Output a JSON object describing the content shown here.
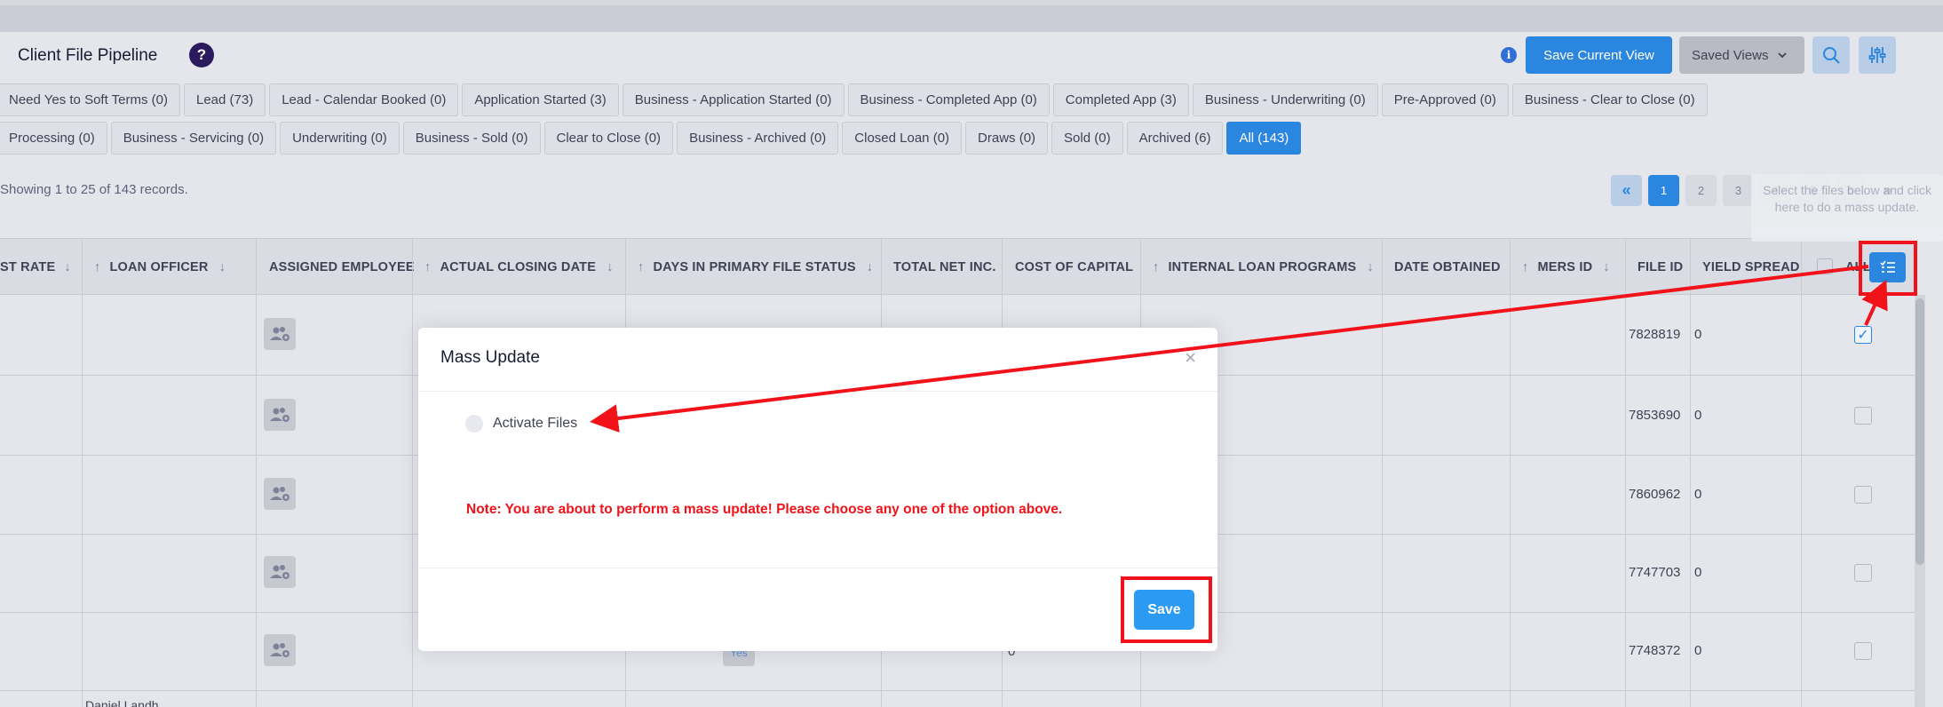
{
  "header": {
    "title": "Client File Pipeline",
    "save_view_label": "Save Current View",
    "saved_views_label": "Saved Views",
    "icons": [
      "help-icon",
      "info-icon",
      "search-icon",
      "filter-settings-icon"
    ]
  },
  "tabs_row1": [
    "Need Yes to Soft Terms (0)",
    "Lead (73)",
    "Lead - Calendar Booked (0)",
    "Application Started (3)",
    "Business - Application Started (0)",
    "Business - Completed App (0)",
    "Completed App (3)",
    "Business - Underwriting (0)",
    "Pre-Approved (0)",
    "Business - Clear to Close (0)"
  ],
  "tabs_row2": [
    "Processing (0)",
    "Business - Servicing (0)",
    "Underwriting (0)",
    "Business - Sold (0)",
    "Clear to Close (0)",
    "Business - Archived (0)",
    "Closed Loan (0)",
    "Draws (0)",
    "Sold (0)",
    "Archived (6)",
    "All (143)"
  ],
  "active_tab": "All (143)",
  "records_text": "Showing 1 to 25 of 143 records.",
  "pagination": {
    "pages": [
      "1",
      "2",
      "3",
      "4",
      "5",
      "6"
    ],
    "current": "1",
    "first": "«",
    "next": "»"
  },
  "tooltip": "Select the files below and click here to do a mass update.",
  "table": {
    "headers": [
      "ST RATE",
      "LOAN OFFICER",
      "ASSIGNED EMPLOYEE",
      "ACTUAL CLOSING DATE",
      "DAYS IN PRIMARY FILE STATUS",
      "TOTAL NET INC.",
      "COST OF CAPITAL",
      "INTERNAL LOAN PROGRAMS",
      "DATE OBTAINED",
      "MERS ID",
      "FILE ID",
      "YIELD SPREAD",
      "ALL"
    ],
    "rows": [
      {
        "file_id": "7828819",
        "yield": "0",
        "checked": true
      },
      {
        "file_id": "7853690",
        "yield": "0",
        "checked": false
      },
      {
        "file_id": "7860962",
        "yield": "0",
        "checked": false
      },
      {
        "file_id": "7747703",
        "yield": "0",
        "checked": false
      },
      {
        "file_id": "7748372",
        "yield": "0",
        "checked": false
      }
    ],
    "row5_partial_status": "Yes",
    "row5_partial_value": "0",
    "bottom_partial_text": "Daniel Landh..."
  },
  "modal": {
    "title": "Mass Update",
    "close": "×",
    "option_label": "Activate Files",
    "note": "Note: You are about to perform a mass update! Please choose any one of the option above.",
    "save_label": "Save"
  },
  "colors": {
    "primary": "#2b86e0",
    "annotation": "#f1121a",
    "note": "#f1121a",
    "title_dark": "#2b1a5e"
  }
}
